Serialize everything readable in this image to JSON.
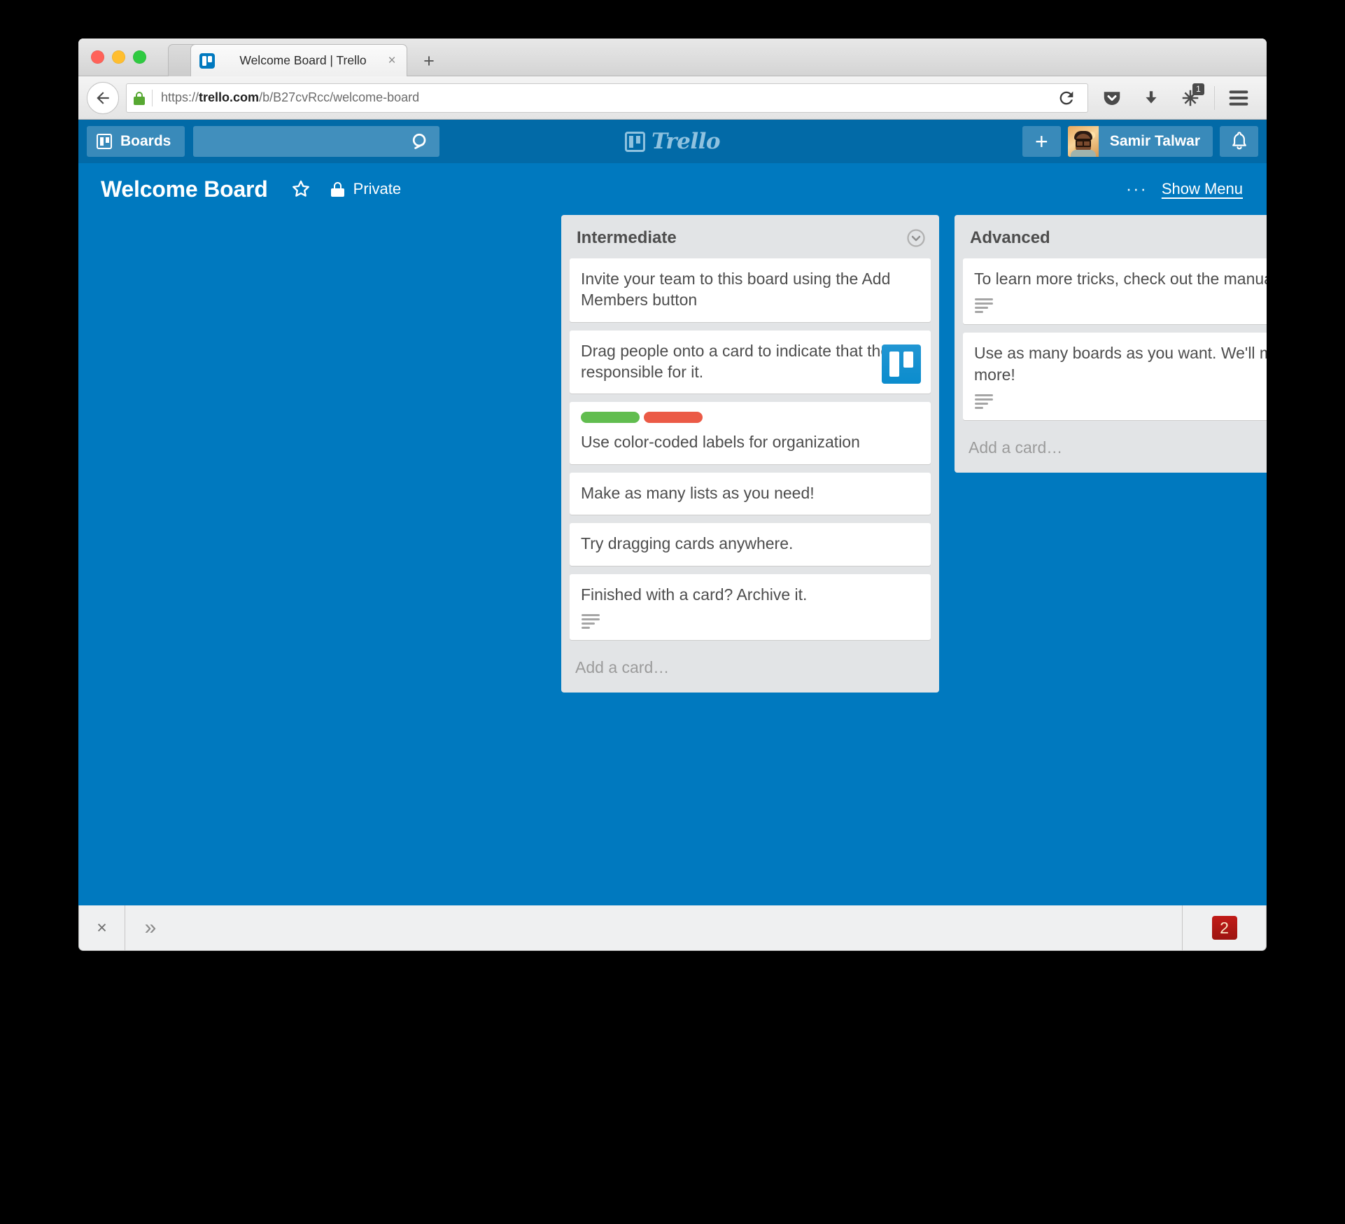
{
  "browser": {
    "tab": {
      "title": "Welcome Board | Trello",
      "favicon": "trello-favicon",
      "close_label": "×"
    },
    "new_tab_label": "+",
    "url": {
      "scheme": "https://",
      "host": "trello.com",
      "path": "/b/B27cvRcc/welcome-board",
      "full": "https://trello.com/b/B27cvRcc/welcome-board"
    },
    "toolbar": {
      "back_label": "Back",
      "reload_label": "Reload",
      "pocket_label": "Pocket",
      "downloads_label": "Downloads",
      "extension_badge": "1",
      "menu_label": "Open menu"
    }
  },
  "trello_header": {
    "boards_label": "Boards",
    "search_placeholder": "",
    "search_value": "",
    "logo_text": "Trello",
    "add_label": "+",
    "member_name": "Samir Talwar",
    "notifications_label": "Notifications"
  },
  "board": {
    "title": "Welcome Board",
    "star_label": "Star board",
    "visibility": "Private",
    "menu_dots": "···",
    "show_menu_label": "Show Menu",
    "background_color": "#0079bf"
  },
  "lists": [
    {
      "name": "Intermediate",
      "add_card_label": "Add a card…",
      "cards": [
        {
          "text": "Invite your team to this board using the Add Members button",
          "labels": [],
          "has_description": false,
          "avatar": false
        },
        {
          "text": "Drag people onto a card to indicate that they're responsible for it.",
          "labels": [],
          "has_description": false,
          "avatar": true
        },
        {
          "text": "Use color-coded labels for organization",
          "labels": [
            "#61bd4f",
            "#eb5a46"
          ],
          "has_description": false,
          "avatar": false
        },
        {
          "text": "Make as many lists as you need!",
          "labels": [],
          "has_description": false,
          "avatar": false
        },
        {
          "text": "Try dragging cards anywhere.",
          "labels": [],
          "has_description": false,
          "avatar": false
        },
        {
          "text": "Finished with a card? Archive it.",
          "labels": [],
          "has_description": true,
          "avatar": false
        }
      ]
    },
    {
      "name": "Advanced",
      "add_card_label": "Add a card…",
      "cards": [
        {
          "text": "To learn more tricks, check out the manual.",
          "labels": [],
          "has_description": true,
          "avatar": false
        },
        {
          "text": "Use as many boards as you want. We'll make more!",
          "labels": [],
          "has_description": true,
          "avatar": false
        }
      ]
    }
  ],
  "devbar": {
    "close_label": "×",
    "chevron_label": "»",
    "error_count": "2"
  }
}
